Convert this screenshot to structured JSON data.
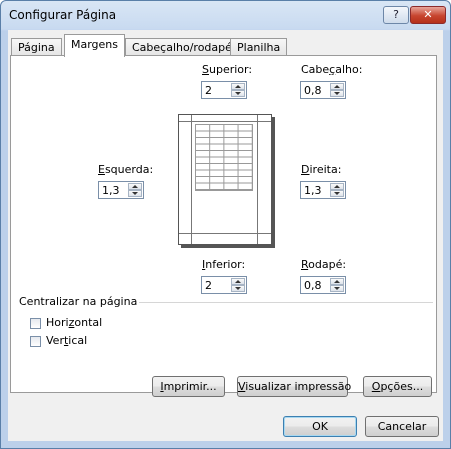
{
  "window": {
    "title": "Configurar Página",
    "help_glyph": "?",
    "close_glyph": "✕"
  },
  "tabs": [
    {
      "label": "Página"
    },
    {
      "label": "Margens"
    },
    {
      "label": "Cabeçalho/rodapé"
    },
    {
      "label": "Planilha"
    }
  ],
  "margins": {
    "superior": {
      "accel": "S",
      "rest": "uperior:",
      "value": "2"
    },
    "cabecalho": {
      "pre": "Cabe",
      "accel": "ç",
      "rest": "alho:",
      "value": "0,8"
    },
    "esquerda": {
      "accel": "E",
      "rest": "squerda:",
      "value": "1,3"
    },
    "direita": {
      "accel": "D",
      "rest": "ireita:",
      "value": "1,3"
    },
    "inferior": {
      "accel": "I",
      "rest": "nferior:",
      "value": "2"
    },
    "rodape": {
      "accel": "R",
      "rest": "odapé:",
      "value": "0,8"
    }
  },
  "center": {
    "title": "Centralizar na página",
    "horizontal": {
      "pre": "Hori",
      "accel": "z",
      "rest": "ontal"
    },
    "vertical": {
      "pre": "Ver",
      "accel": "t",
      "rest": "ical"
    }
  },
  "buttons": {
    "imprimir": {
      "accel": "I",
      "rest": "mprimir..."
    },
    "visualizar": {
      "accel": "V",
      "rest": "isualizar impressão"
    },
    "opcoes": {
      "accel": "O",
      "rest": "pções..."
    },
    "ok": "OK",
    "cancelar": "Cancelar"
  }
}
